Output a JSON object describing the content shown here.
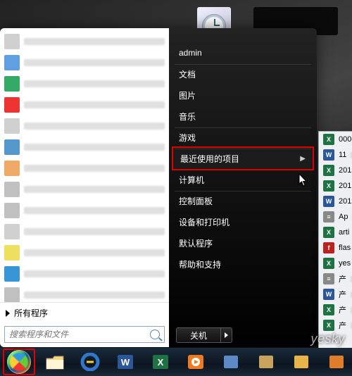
{
  "user": {
    "name": "admin"
  },
  "right_items": [
    {
      "label": "admin",
      "sep": true
    },
    {
      "label": "文档"
    },
    {
      "label": "图片"
    },
    {
      "label": "音乐",
      "sep": true
    },
    {
      "label": "游戏",
      "sep": true
    },
    {
      "label": "最近使用的项目",
      "submenu": true,
      "highlight": true
    },
    {
      "label": "计算机",
      "sep": true
    },
    {
      "label": "控制面板"
    },
    {
      "label": "设备和打印机"
    },
    {
      "label": "默认程序"
    },
    {
      "label": "帮助和支持"
    }
  ],
  "all_programs": "所有程序",
  "search": {
    "placeholder": "搜索程序和文件"
  },
  "shutdown": {
    "label": "关机"
  },
  "recent_items": [
    {
      "icon": "xls",
      "prefix": "000"
    },
    {
      "icon": "doc",
      "prefix": "11"
    },
    {
      "icon": "xls",
      "prefix": "201"
    },
    {
      "icon": "xls",
      "prefix": "201"
    },
    {
      "icon": "doc",
      "prefix": "201"
    },
    {
      "icon": "txt",
      "prefix": "Ap"
    },
    {
      "icon": "xls",
      "prefix": "arti"
    },
    {
      "icon": "fla",
      "prefix": "flas"
    },
    {
      "icon": "xls",
      "prefix": "yes"
    },
    {
      "icon": "txt",
      "prefix": "产"
    },
    {
      "icon": "doc",
      "prefix": "产"
    },
    {
      "icon": "xls",
      "prefix": "产"
    },
    {
      "icon": "xls",
      "prefix": "产"
    }
  ],
  "prog_icons": [
    "#d0d0d0",
    "#60a0e0",
    "#3a6",
    "#e33",
    "#d0d0d0",
    "#59c",
    "#ea6",
    "#c0c0c0",
    "#c0c0c0",
    "#d0d0d0",
    "#f0e060",
    "#3996d6",
    "#c0c0c0"
  ],
  "taskbar": {
    "buttons": [
      {
        "name": "start",
        "hl": true
      },
      {
        "name": "explorer",
        "color": "#f6d77c"
      },
      {
        "name": "ie",
        "color": "#2e78c7"
      },
      {
        "name": "word",
        "color": "#2b579a"
      },
      {
        "name": "excel",
        "color": "#1f7244"
      },
      {
        "name": "mediaplayer",
        "color": "#f07a1f"
      },
      {
        "name": "app1",
        "color": "#5d8ac7"
      },
      {
        "name": "app2",
        "color": "#c9a35b"
      },
      {
        "name": "app3",
        "color": "#e8b44a"
      },
      {
        "name": "app4",
        "color": "#e07d2c"
      }
    ]
  },
  "watermark": "yesky",
  "icon_colors": {
    "xls": "#1f7244",
    "doc": "#2b579a",
    "txt": "#888",
    "fla": "#b22"
  },
  "icon_letters": {
    "xls": "X",
    "doc": "W",
    "txt": "≡",
    "fla": "f"
  }
}
